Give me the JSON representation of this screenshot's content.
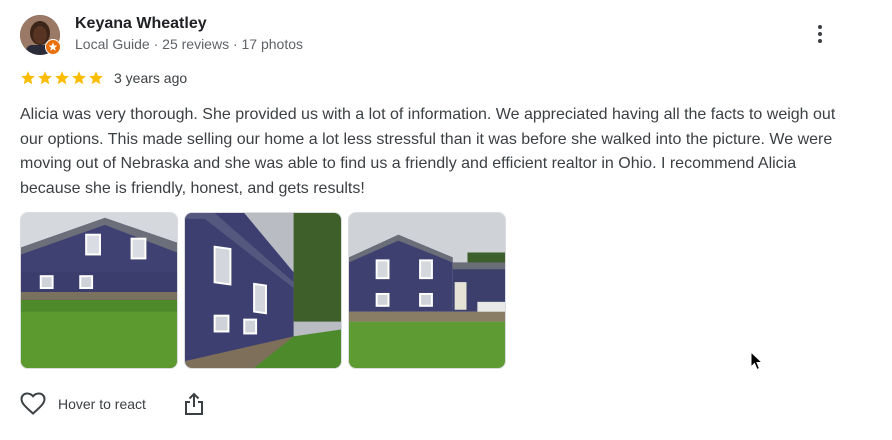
{
  "reviewer": {
    "name": "Keyana Wheatley",
    "meta": "Local Guide · 25 reviews · 17 photos",
    "avatar_icon": "avatar-photo",
    "badge_icon": "local-guide-star-badge"
  },
  "rating": {
    "stars": 5,
    "max_stars": 5,
    "time": "3 years ago",
    "star_color": "#fbbc04"
  },
  "review_text": "Alicia was very thorough. She provided us with a lot of information. We appreciated having all the facts to weigh out our options. This made selling our home a lot less stressful than it was before she walked into the picture. We were moving out of Nebraska and she was able to find us a friendly and efficient realtor in Ohio. I recommend Alicia because she is friendly, honest, and gets results!",
  "photos": [
    {
      "icon": "house-photo-1"
    },
    {
      "icon": "house-photo-2"
    },
    {
      "icon": "house-photo-3"
    }
  ],
  "actions": {
    "react_label": "Hover to react",
    "react_icon": "heart-outline-icon",
    "share_icon": "share-icon"
  },
  "menu_icon": "more-vert-icon"
}
